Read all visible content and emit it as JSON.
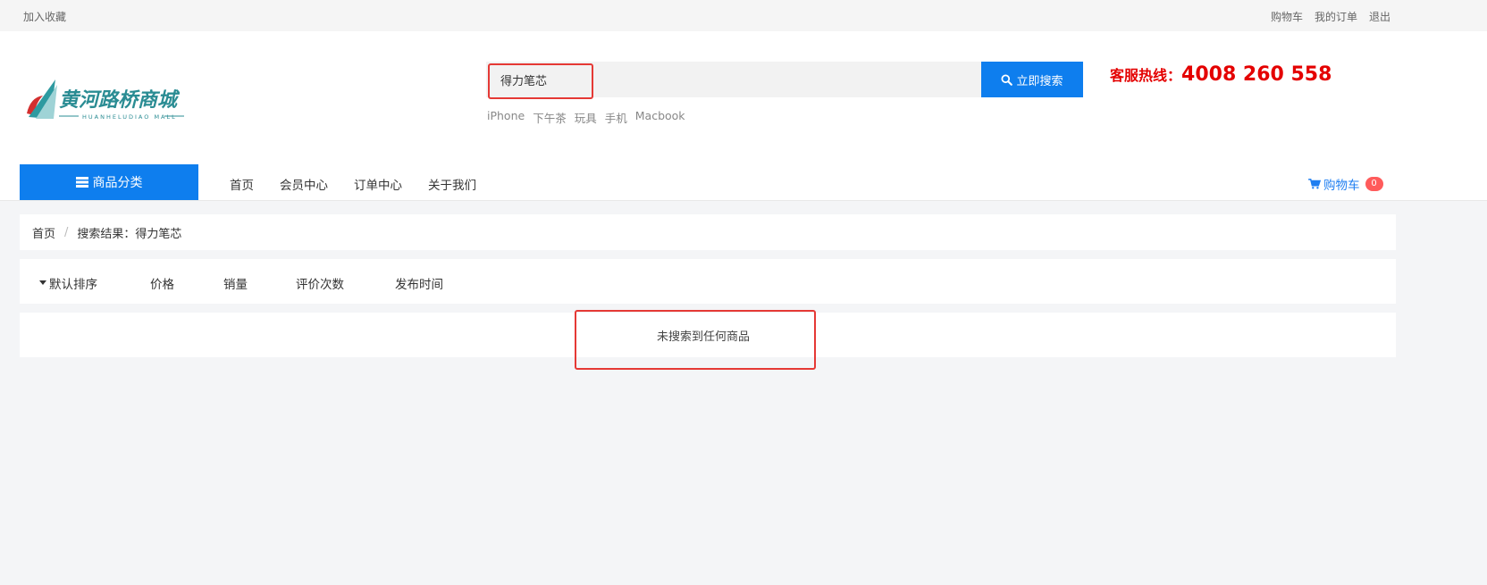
{
  "topbar": {
    "favorite": "加入收藏",
    "links": [
      "购物车",
      "我的订单",
      "退出"
    ]
  },
  "logo": {
    "cn": "黄河路桥商城",
    "en": "HUANHELUDIAO MALL"
  },
  "search": {
    "value": "得力笔芯",
    "button_label": "立即搜索",
    "hot_keywords": [
      "iPhone",
      "下午茶",
      "玩具",
      "手机",
      "Macbook"
    ]
  },
  "hotline": {
    "label": "客服热线：",
    "number": "4008 260 558"
  },
  "nav": {
    "category_label": "商品分类",
    "links": [
      "首页",
      "会员中心",
      "订单中心",
      "关于我们"
    ],
    "cart_label": "购物车",
    "cart_count": "0"
  },
  "breadcrumb": {
    "home": "首页",
    "separator": "/",
    "current": "搜索结果：得力笔芯"
  },
  "sort": {
    "items": [
      "默认排序",
      "价格",
      "销量",
      "评价次数",
      "发布时间"
    ]
  },
  "result": {
    "message": "未搜索到任何商品"
  },
  "colors": {
    "primary": "#0e7eee",
    "hotline": "#e40000",
    "highlight": "#e53935",
    "badge": "#ff5b5b"
  },
  "icons": {
    "search": "search-icon",
    "category": "list-icon",
    "cart": "shopping-cart-icon",
    "sort": "caret-down-icon"
  }
}
